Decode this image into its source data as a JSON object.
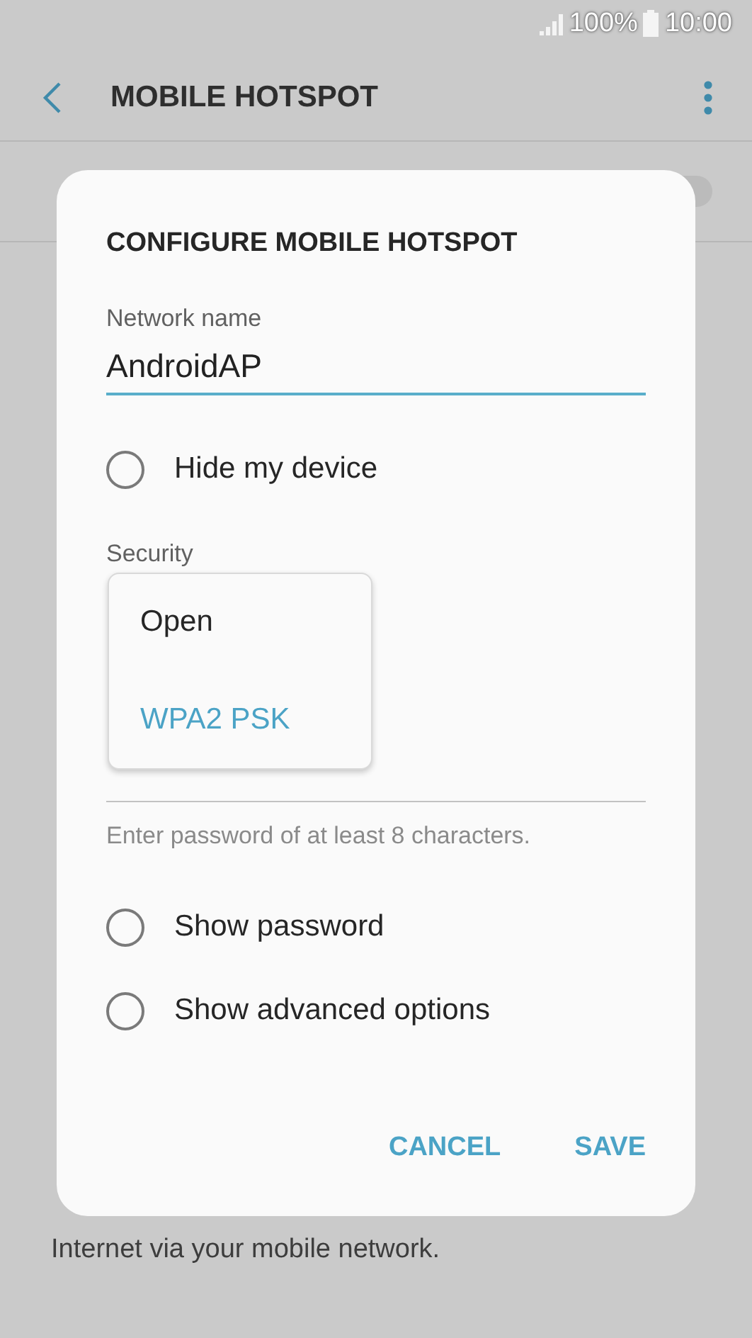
{
  "status_bar": {
    "battery": "100%",
    "time": "10:00"
  },
  "header": {
    "title": "MOBILE HOTSPOT"
  },
  "hotspot_toggle": {
    "on": false
  },
  "background_text": "Internet via your mobile network.",
  "dialog": {
    "title": "CONFIGURE MOBILE HOTSPOT",
    "network_name": {
      "label": "Network name",
      "value": "AndroidAP"
    },
    "hide_device": {
      "label": "Hide my device",
      "checked": false
    },
    "security": {
      "label": "Security",
      "options": [
        {
          "label": "Open",
          "selected": false
        },
        {
          "label": "WPA2 PSK",
          "selected": true
        }
      ]
    },
    "password_hint": "Enter password of at least 8 characters.",
    "options": [
      {
        "label": "Show password",
        "checked": false
      },
      {
        "label": "Show advanced options",
        "checked": false
      }
    ],
    "buttons": [
      "CANCEL",
      "SAVE"
    ]
  }
}
